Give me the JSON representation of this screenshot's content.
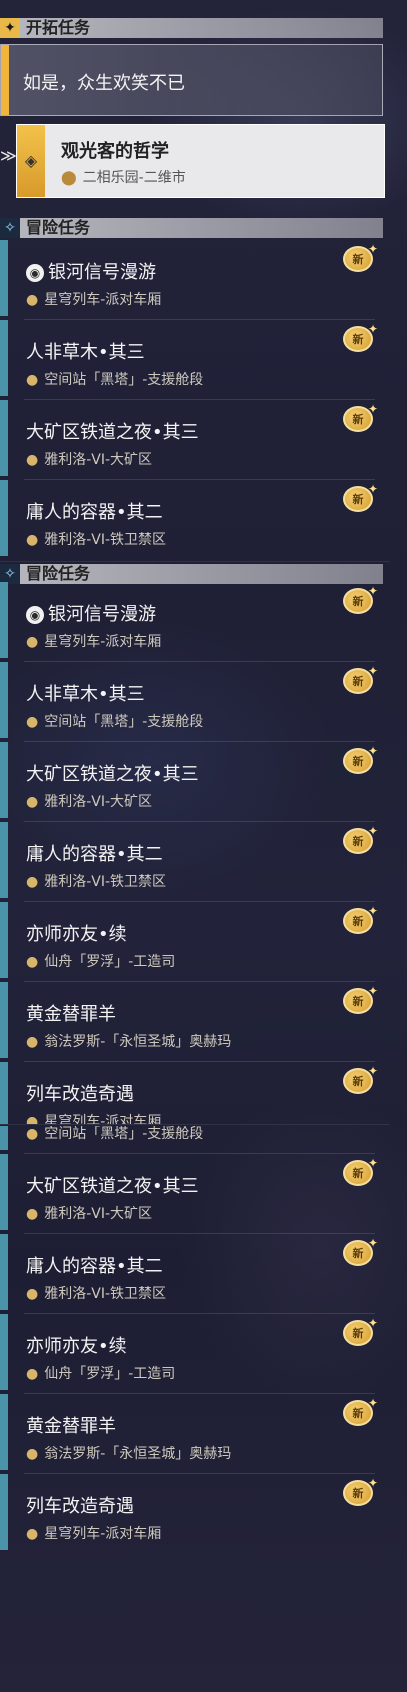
{
  "section1": {
    "trailblaze_header": "开拓任务",
    "trailblaze_card": "如是，众生欢笑不已",
    "selected": {
      "name": "观光客的哲学",
      "location": "二相乐园-二维市"
    },
    "adventure_header": "冒险任务",
    "items": [
      {
        "name": "银河信号漫游",
        "location": "星穹列车-派对车厢",
        "badge": "新",
        "icon": "disc-icon"
      },
      {
        "name": "人非草木•其三",
        "location": "空间站「黑塔」-支援舱段",
        "badge": "新"
      },
      {
        "name": "大矿区铁道之夜•其三",
        "location": "雅利洛-VI-大矿区",
        "badge": "新"
      },
      {
        "name": "庸人的容器•其二",
        "location": "雅利洛-VI-铁卫禁区",
        "badge": "新"
      }
    ]
  },
  "section2": {
    "adventure_header": "冒险任务",
    "items": [
      {
        "name": "银河信号漫游",
        "location": "星穹列车-派对车厢",
        "badge": "新",
        "icon": "disc-icon"
      },
      {
        "name": "人非草木•其三",
        "location": "空间站「黑塔」-支援舱段",
        "badge": "新"
      },
      {
        "name": "大矿区铁道之夜•其三",
        "location": "雅利洛-VI-大矿区",
        "badge": "新"
      },
      {
        "name": "庸人的容器•其二",
        "location": "雅利洛-VI-铁卫禁区",
        "badge": "新"
      },
      {
        "name": "亦师亦友•续",
        "location": "仙舟「罗浮」-工造司",
        "badge": "新"
      },
      {
        "name": "黄金替罪羊",
        "location": "翁法罗斯-「永恒圣城」奥赫玛",
        "badge": "新"
      },
      {
        "name": "列车改造奇遇",
        "location": "星穹列车-派对车厢",
        "badge": "新"
      }
    ]
  },
  "section3": {
    "partial_location": "空间站「黑塔」-支援舱段",
    "items": [
      {
        "name": "大矿区铁道之夜•其三",
        "location": "雅利洛-VI-大矿区",
        "badge": "新"
      },
      {
        "name": "庸人的容器•其二",
        "location": "雅利洛-VI-铁卫禁区",
        "badge": "新"
      },
      {
        "name": "亦师亦友•续",
        "location": "仙舟「罗浮」-工造司",
        "badge": "新"
      },
      {
        "name": "黄金替罪羊",
        "location": "翁法罗斯-「永恒圣城」奥赫玛",
        "badge": "新"
      },
      {
        "name": "列车改造奇遇",
        "location": "星穹列车-派对车厢",
        "badge": "新"
      }
    ]
  },
  "colors": {
    "accent_gold": "#f1b43c",
    "item_bar": "#4a93a8",
    "badge": "#e2ac3c"
  }
}
